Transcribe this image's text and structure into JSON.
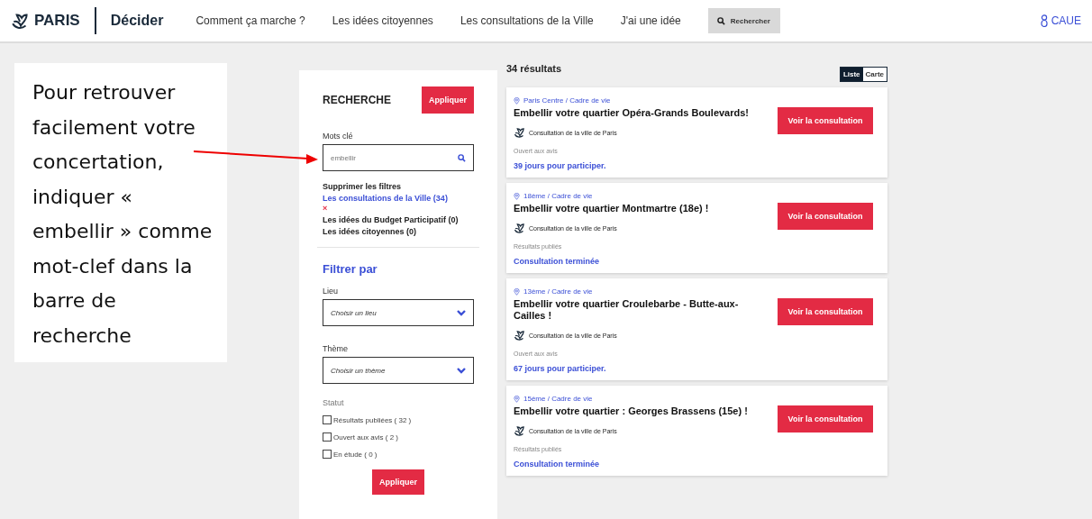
{
  "header": {
    "brand": "PARIS",
    "section": "Décider",
    "nav": [
      {
        "label": "Comment ça marche ?"
      },
      {
        "label": "Les idées citoyennes"
      },
      {
        "label": "Les consultations de la Ville"
      },
      {
        "label": "J'ai une idée"
      }
    ],
    "search_button": "Rechercher",
    "user": "CAUE"
  },
  "callout": {
    "text": "Pour retrouver facilement votre concertation, indiquer « embellir » comme mot-clef dans la barre de recherche"
  },
  "filters": {
    "title": "RECHERCHE",
    "apply_top": "Appliquer",
    "keywords_label": "Mots clé",
    "keywords_value": "embellir",
    "clear": "Supprimer les filtres",
    "remove_mark": "×",
    "categories": [
      {
        "label": "Les consultations de la Ville (34)",
        "selected": true
      },
      {
        "label": "Les idées du Budget Participatif (0)",
        "selected": false
      },
      {
        "label": "Les idées citoyennes (0)",
        "selected": false
      }
    ],
    "filter_title": "Filtrer par",
    "place_label": "Lieu",
    "place_placeholder": "Choisir un lieu",
    "theme_label": "Thème",
    "theme_placeholder": "Choisir un thème",
    "status_label": "Statut",
    "statuses": [
      {
        "label": "Résultats publiées ( 32 )",
        "checked": false
      },
      {
        "label": "Ouvert aux avis ( 2 )",
        "checked": false
      },
      {
        "label": "En étude ( 0 )",
        "checked": false
      }
    ],
    "apply_bottom": "Appliquer"
  },
  "results": {
    "count": "34 résultats",
    "views": [
      {
        "label": "Liste",
        "selected": true
      },
      {
        "label": "Carte",
        "selected": false
      }
    ],
    "cards": [
      {
        "location": "Paris Centre / Cadre de vie",
        "title": "Embellir votre quartier Opéra-Grands Boulevards!",
        "source": "Consultation de la ville de Paris",
        "status": "Ouvert aux avis",
        "note": "39 jours pour participer.",
        "button": "Voir la consultation"
      },
      {
        "location": "18ème / Cadre de vie",
        "title": "Embellir votre quartier Montmartre (18e) !",
        "source": "Consultation de la ville de Paris",
        "status": "Résultats publiés",
        "note": "Consultation terminée",
        "button": "Voir la consultation"
      },
      {
        "location": "13ème / Cadre de vie",
        "title": "Embellir votre quartier Croulebarbe - Butte-aux-Cailles !",
        "source": "Consultation de la ville de Paris",
        "status": "Ouvert aux avis",
        "note": "67 jours pour participer.",
        "button": "Voir la consultation"
      },
      {
        "location": "15ème / Cadre de vie",
        "title": "Embellir votre quartier : Georges Brassens (15e) !",
        "source": "Consultation de la ville de Paris",
        "status": "Résultats publiés",
        "note": "Consultation terminée",
        "button": "Voir la consultation"
      }
    ]
  }
}
